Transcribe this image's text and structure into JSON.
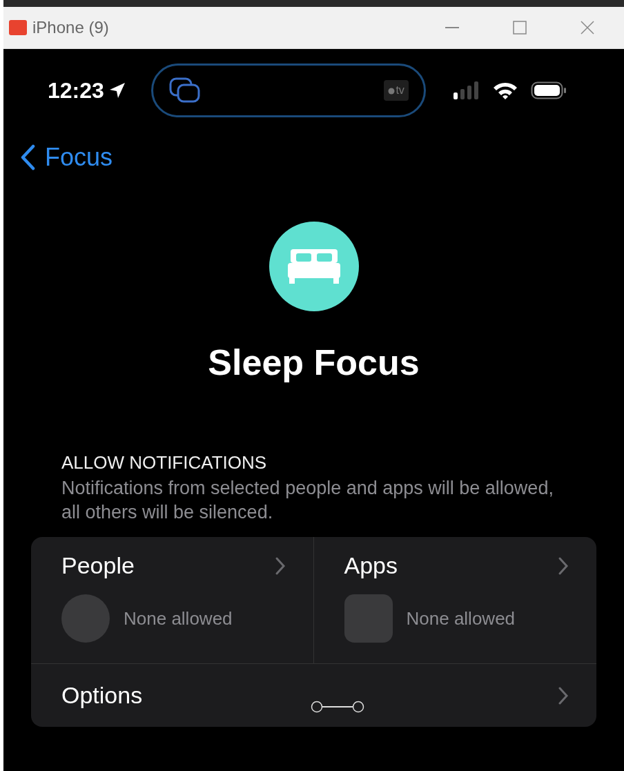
{
  "window": {
    "title": "iPhone (9)"
  },
  "status_bar": {
    "time": "12:23",
    "island_badge": "tv"
  },
  "nav": {
    "back_label": "Focus"
  },
  "focus": {
    "title": "Sleep Focus",
    "color": "#5fe0d0"
  },
  "section": {
    "header": "ALLOW NOTIFICATIONS",
    "description": "Notifications from selected people and apps will be allowed, all others will be silenced."
  },
  "tiles": [
    {
      "kind": "people",
      "label": "People",
      "value": "None allowed"
    },
    {
      "kind": "apps",
      "label": "Apps",
      "value": "None allowed"
    }
  ],
  "options": {
    "label": "Options"
  }
}
